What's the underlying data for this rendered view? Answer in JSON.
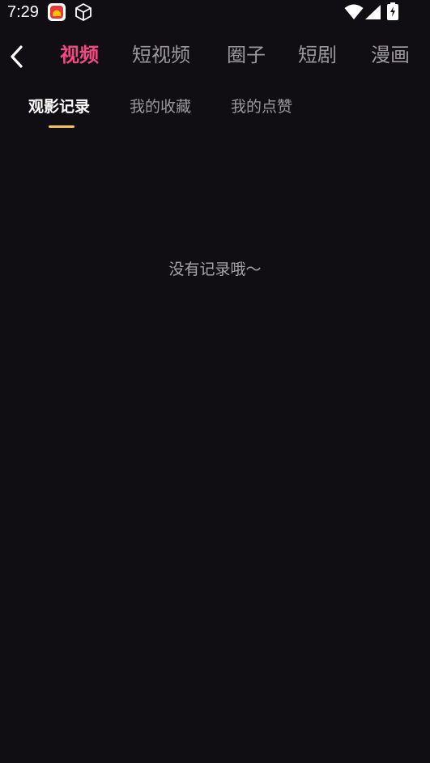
{
  "status_bar": {
    "time": "7:29",
    "icons": [
      "app-notification-icon",
      "package-box-icon",
      "wifi-icon",
      "cell-signal-icon",
      "battery-charging-icon"
    ]
  },
  "top_nav": {
    "back_icon": "chevron-left-icon",
    "tabs": [
      {
        "label": "视频",
        "active": true
      },
      {
        "label": "短视频",
        "active": false
      },
      {
        "label": "圈子",
        "active": false
      },
      {
        "label": "短剧",
        "active": false
      },
      {
        "label": "漫画",
        "active": false
      }
    ],
    "active_color": "#f14a82",
    "inactive_color": "#9a989c"
  },
  "sub_tabs": {
    "tabs": [
      {
        "label": "观影记录",
        "active": true
      },
      {
        "label": "我的收藏",
        "active": false
      },
      {
        "label": "我的点赞",
        "active": false
      }
    ],
    "indicator_color": "#f4c35a"
  },
  "empty_state": {
    "message": "没有记录哦～"
  },
  "colors": {
    "background": "#110e13"
  }
}
